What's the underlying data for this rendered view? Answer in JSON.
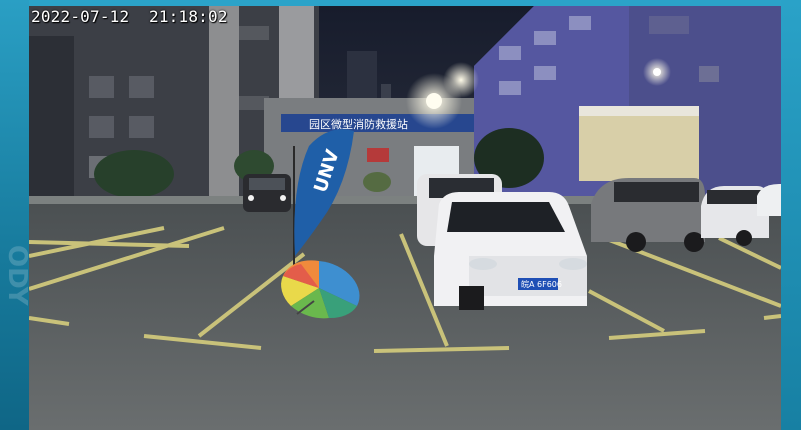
{
  "overlay": {
    "date": "2022-07-12",
    "time": "21:18:02"
  },
  "scene": {
    "building_sign": "园区微型消防救援站",
    "flag_text": "UNV",
    "license_plate": "皖A 6F606",
    "frame_watermark": "ODY"
  },
  "colors": {
    "frame": "#1f8fb0",
    "sky": "#1c2233",
    "pavement": "#5b5f61",
    "parking_lines": "#c9c27a",
    "flag": "#1f5fa8"
  }
}
